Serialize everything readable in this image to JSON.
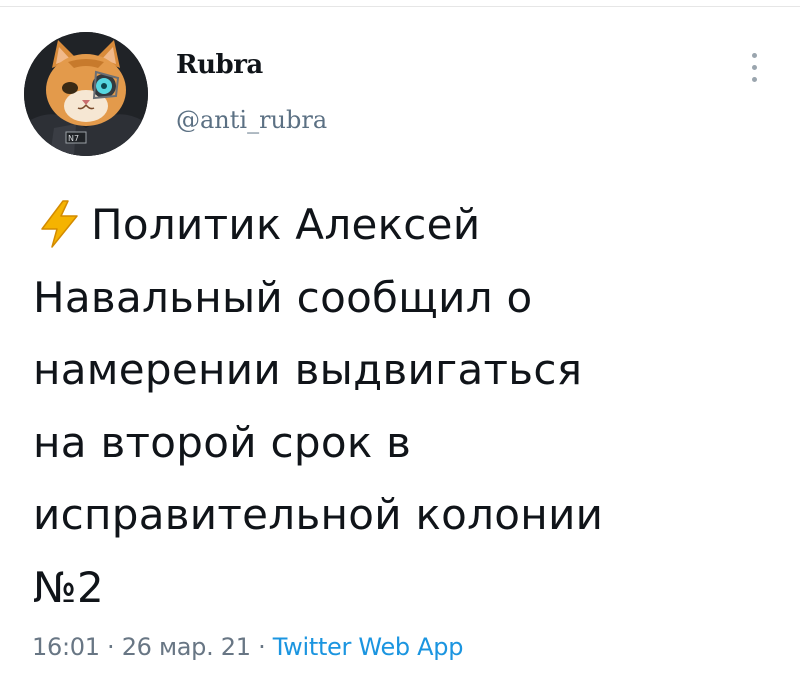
{
  "tweet": {
    "author": {
      "display_name": "Rubra",
      "handle": "@anti_rubra",
      "avatar_badge": "N7"
    },
    "text_lines": [
      "Политик Алексей",
      "Навальный сообщил о",
      "намерении выдвигаться",
      "на второй срок в",
      "исправительной колонии",
      "№2"
    ],
    "leading_icon": "high-voltage-icon",
    "meta": {
      "time": "16:01",
      "separator": "·",
      "date": "26 мар. 21",
      "source": "Twitter Web App"
    },
    "menu_icon": "vertical-ellipsis-icon"
  },
  "colors": {
    "text": "#101419",
    "secondary": "#5b7083",
    "link": "#1b95e0",
    "bolt": "#f5b301"
  }
}
